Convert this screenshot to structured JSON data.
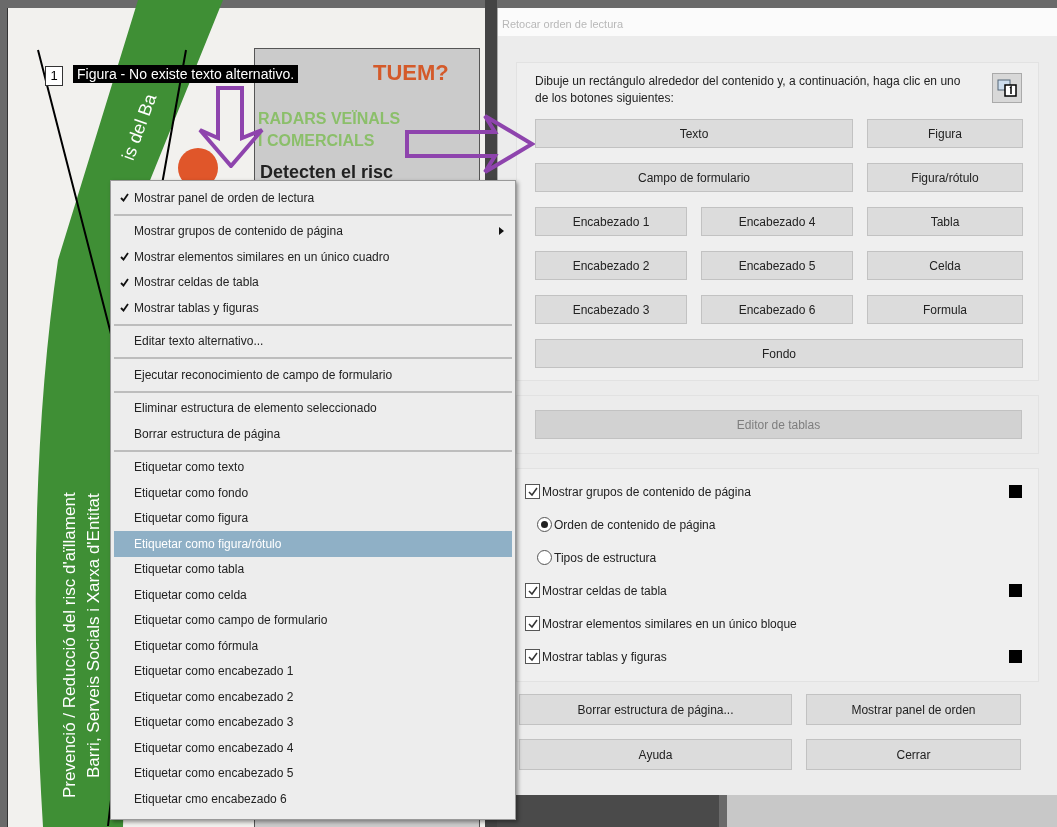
{
  "document": {
    "badge": "1",
    "tooltip": "Figura - No existe texto alternativo.",
    "heading": "TUEM?",
    "subheading_lines": [
      "RADARS VEÏNALS",
      "I COMERCIALS"
    ],
    "body": "Detecten el risc",
    "band_texts": [
      "is del Ba",
      "Prevenció / Reducció del risc d'aïllament",
      "Barri, Serveis Socials i Xarxa d'Entitat"
    ]
  },
  "context_menu": {
    "items": [
      {
        "kind": "item",
        "label": "Mostrar panel de orden de lectura",
        "checked": true,
        "submenu": false,
        "selected": false
      },
      {
        "kind": "separator"
      },
      {
        "kind": "item",
        "label": "Mostrar grupos de contenido de página",
        "checked": false,
        "submenu": true,
        "selected": false
      },
      {
        "kind": "item",
        "label": "Mostrar elementos similares en un único cuadro",
        "checked": true,
        "submenu": false,
        "selected": false
      },
      {
        "kind": "item",
        "label": "Mostrar celdas de tabla",
        "checked": true,
        "submenu": false,
        "selected": false
      },
      {
        "kind": "item",
        "label": "Mostrar tablas y figuras",
        "checked": true,
        "submenu": false,
        "selected": false
      },
      {
        "kind": "separator"
      },
      {
        "kind": "item",
        "label": "Editar texto alternativo...",
        "checked": false,
        "submenu": false,
        "selected": false
      },
      {
        "kind": "separator"
      },
      {
        "kind": "item",
        "label": "Ejecutar reconocimiento de campo de formulario",
        "checked": false,
        "submenu": false,
        "selected": false
      },
      {
        "kind": "separator"
      },
      {
        "kind": "item",
        "label": "Eliminar estructura de elemento seleccionado",
        "checked": false,
        "submenu": false,
        "selected": false
      },
      {
        "kind": "item",
        "label": "Borrar estructura de página",
        "checked": false,
        "submenu": false,
        "selected": false
      },
      {
        "kind": "separator"
      },
      {
        "kind": "item",
        "label": "Etiquetar como texto",
        "checked": false,
        "submenu": false,
        "selected": false
      },
      {
        "kind": "item",
        "label": "Etiquetar como fondo",
        "checked": false,
        "submenu": false,
        "selected": false
      },
      {
        "kind": "item",
        "label": "Etiquetar como figura",
        "checked": false,
        "submenu": false,
        "selected": false
      },
      {
        "kind": "item",
        "label": "Etiquetar como figura/rótulo",
        "checked": false,
        "submenu": false,
        "selected": true
      },
      {
        "kind": "item",
        "label": "Etiquetar como tabla",
        "checked": false,
        "submenu": false,
        "selected": false
      },
      {
        "kind": "item",
        "label": "Etiquetar como celda",
        "checked": false,
        "submenu": false,
        "selected": false
      },
      {
        "kind": "item",
        "label": "Etiquetar como campo de formulario",
        "checked": false,
        "submenu": false,
        "selected": false
      },
      {
        "kind": "item",
        "label": "Etiquetar como fórmula",
        "checked": false,
        "submenu": false,
        "selected": false
      },
      {
        "kind": "item",
        "label": "Etiquetar como encabezado 1",
        "checked": false,
        "submenu": false,
        "selected": false
      },
      {
        "kind": "item",
        "label": "Etiquetar como encabezado 2",
        "checked": false,
        "submenu": false,
        "selected": false
      },
      {
        "kind": "item",
        "label": "Etiquetar como encabezado 3",
        "checked": false,
        "submenu": false,
        "selected": false
      },
      {
        "kind": "item",
        "label": "Etiquetar como encabezado 4",
        "checked": false,
        "submenu": false,
        "selected": false
      },
      {
        "kind": "item",
        "label": "Etiquetar como encabezado 5",
        "checked": false,
        "submenu": false,
        "selected": false
      },
      {
        "kind": "item",
        "label": "Etiquetar cmo encabezado 6",
        "checked": false,
        "submenu": false,
        "selected": false
      }
    ]
  },
  "dialog": {
    "title": "Retocar orden de lectura",
    "instruction": "Dibuje un rectángulo alrededor del contenido y, a continuación, haga clic en uno de los botones siguientes:",
    "tag_button_rows": [
      [
        "Texto",
        "Figura"
      ],
      [
        "Campo de formulario",
        "Figura/rótulo"
      ],
      [
        "Encabezado 1",
        "Encabezado 4",
        "Tabla"
      ],
      [
        "Encabezado 2",
        "Encabezado 5",
        "Celda"
      ],
      [
        "Encabezado 3",
        "Encabezado 6",
        "Formula"
      ],
      [
        "Fondo"
      ]
    ],
    "table_editor": {
      "label": "Editor de tablas",
      "disabled": true
    },
    "options": [
      {
        "kind": "checkbox",
        "label": "Mostrar grupos de contenido de página",
        "checked": true,
        "color": "#000000"
      },
      {
        "kind": "radio",
        "label": "Orden de contenido de página",
        "selected": true
      },
      {
        "kind": "radio",
        "label": "Tipos de estructura",
        "selected": false
      },
      {
        "kind": "checkbox",
        "label": "Mostrar celdas de tabla",
        "checked": true,
        "color": "#000000"
      },
      {
        "kind": "checkbox",
        "label": "Mostrar elementos similares en un único bloque",
        "checked": true
      },
      {
        "kind": "checkbox",
        "label": "Mostrar tablas y figuras",
        "checked": true,
        "color": "#000000"
      }
    ],
    "footer_buttons": [
      "Borrar estructura de página...",
      "Mostrar panel de orden",
      "Ayuda",
      "Cerrar"
    ]
  }
}
